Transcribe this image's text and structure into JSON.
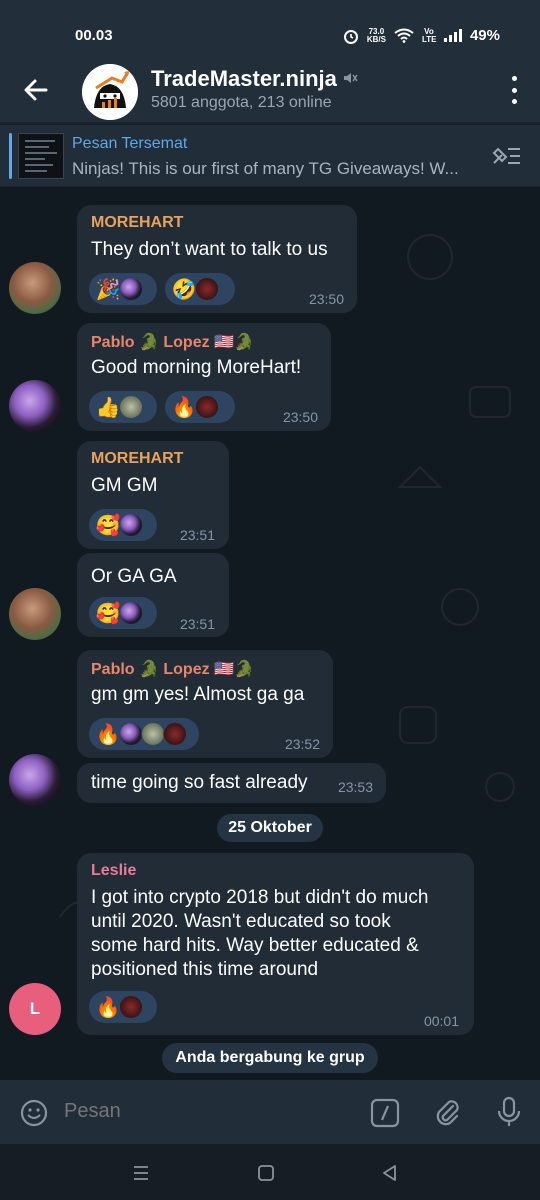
{
  "status_bar": {
    "time": "00.03",
    "net_speed": "73.0",
    "net_unit": "KB/S",
    "volte": "Vo LTE",
    "battery": "49%"
  },
  "header": {
    "title": "TradeMaster.ninja",
    "subtitle": "5801 anggota, 213 online"
  },
  "pinned": {
    "title": "Pesan Tersemat",
    "text": "Ninjas! This is our first of many TG Giveaways!  W..."
  },
  "messages": [
    {
      "sender": "MOREHART",
      "sender_color": "#e8a35a",
      "text": "They don’t want to talk to us",
      "time": "23:50",
      "reactions": [
        [
          "🎉"
        ],
        [
          "🤣"
        ]
      ]
    },
    {
      "sender": "Pablo 🐊 Lopez 🇺🇸🐊",
      "sender_color": "#e8856a",
      "text": "Good morning MoreHart!",
      "time": "23:50",
      "reactions": [
        [
          "👍"
        ],
        [
          "🔥"
        ]
      ]
    },
    {
      "sender": "MOREHART",
      "sender_color": "#e8a35a",
      "text": "GM GM",
      "time": "23:51",
      "reactions": [
        [
          "🥰"
        ]
      ]
    },
    {
      "text": "Or GA GA",
      "time": "23:51",
      "reactions": [
        [
          "🥰"
        ]
      ]
    },
    {
      "sender": "Pablo 🐊 Lopez 🇺🇸🐊",
      "sender_color": "#e8856a",
      "text": "gm gm yes! Almost ga ga",
      "time": "23:52",
      "reactions": [
        [
          "🔥"
        ]
      ]
    },
    {
      "text": "time going so fast already",
      "time": "23:53"
    },
    {
      "sender": "Leslie",
      "sender_color": "#e87a9a",
      "text_lines": [
        "I got into crypto 2018 but didn't do much",
        "until 2020.  Wasn't educated so took",
        "some hard hits.  Way better educated &",
        "positioned this time around"
      ],
      "time": "00:01",
      "reactions": [
        [
          "🔥"
        ]
      ]
    }
  ],
  "date_separator": "25 Oktober",
  "service_message": "Anda bergabung ke grup",
  "avatar_letter": "L",
  "input": {
    "placeholder": "Pesan"
  },
  "colors": {
    "accent": "#5ea8e6",
    "bubble": "#212c37",
    "reaction_bg": "#2d4560",
    "leslie_avatar": "#e85f7e"
  }
}
